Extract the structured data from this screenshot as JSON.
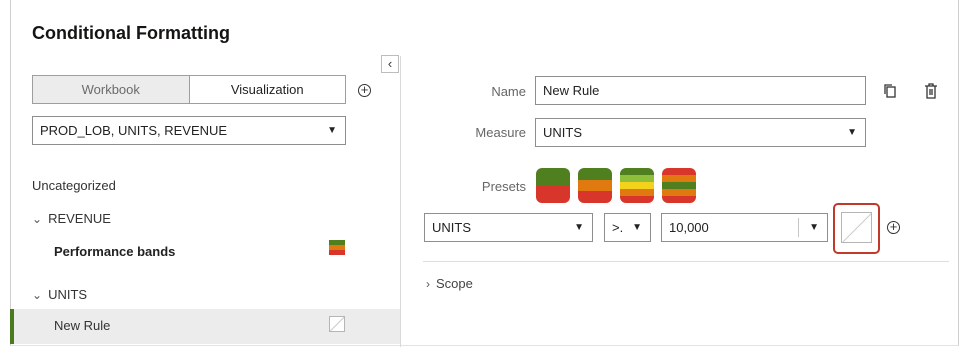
{
  "header": {
    "title": "Conditional Formatting"
  },
  "left": {
    "tabs": [
      {
        "label": "Workbook",
        "active": false
      },
      {
        "label": "Visualization",
        "active": true
      }
    ],
    "measure_select": "PROD_LOB, UNITS, REVENUE",
    "section_label": "Uncategorized",
    "groups": [
      {
        "label": "REVENUE",
        "rules": [
          {
            "label": "Performance bands"
          }
        ]
      },
      {
        "label": "UNITS",
        "rules": [
          {
            "label": "New Rule"
          }
        ]
      }
    ]
  },
  "right": {
    "name_label": "Name",
    "name_value": "New Rule",
    "measure_label": "Measure",
    "measure_value": "UNITS",
    "presets_label": "Presets",
    "condition": {
      "measure": "UNITS",
      "operator": ">.",
      "value": "10,000"
    },
    "scope_label": "Scope"
  },
  "colors": {
    "green": "#4f7f1f",
    "orange": "#e07a10",
    "red": "#d9362b",
    "yellow": "#f3d21c",
    "lightgreen": "#8fbf3a",
    "accent_bar": "#4a7c1f",
    "highlight": "#c0392b"
  },
  "icons": [
    "collapse-left-icon",
    "add-circle-icon",
    "chevron-down-icon",
    "chevron-right-icon",
    "copy-icon",
    "trash-icon",
    "caret-down-icon"
  ]
}
